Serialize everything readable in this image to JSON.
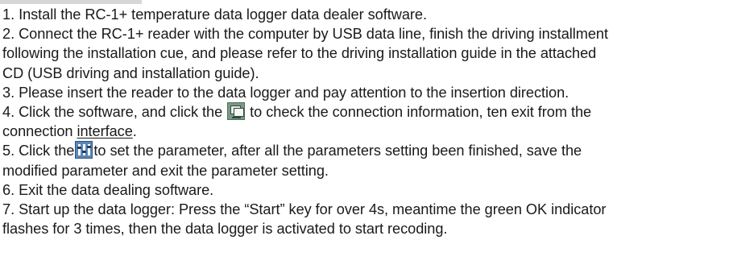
{
  "instructions": {
    "lines": [
      "1. Install the RC-1+ temperature data logger data dealer software.",
      "2. Connect the RC-1+ reader with the computer by USB data line, finish the driving installment",
      "following the installation cue, and please refer to the driving installation guide in the attached",
      "CD (USB driving and installation guide).",
      "3. Please insert the reader to the data logger and pay attention to the insertion direction.",
      {
        "before_icon": "4. Click the software, and click the ",
        "icon": "connection-icon",
        "after_icon": " to check the connection information, ten exit from the"
      },
      {
        "before_underline": "connection ",
        "underlined": "interface",
        "after_underline": "."
      },
      {
        "before_icon": "5. Click the",
        "icon": "parameter-settings-icon",
        "after_icon": "to set the parameter, after all the parameters setting been finished, save the"
      },
      "modified parameter and exit the parameter setting.",
      "6. Exit the data dealing software.",
      "7. Start up the data logger: Press the “Start” key for over 4s, meantime the green OK indicator",
      "flashes for 3 times, then the data logger is activated to start recoding."
    ]
  },
  "colors": {
    "text": "#1a1a1a",
    "header_strip": "#d6d6d6",
    "connection_icon": "#7a9a86",
    "parameter_icon": "#5b87b8"
  }
}
